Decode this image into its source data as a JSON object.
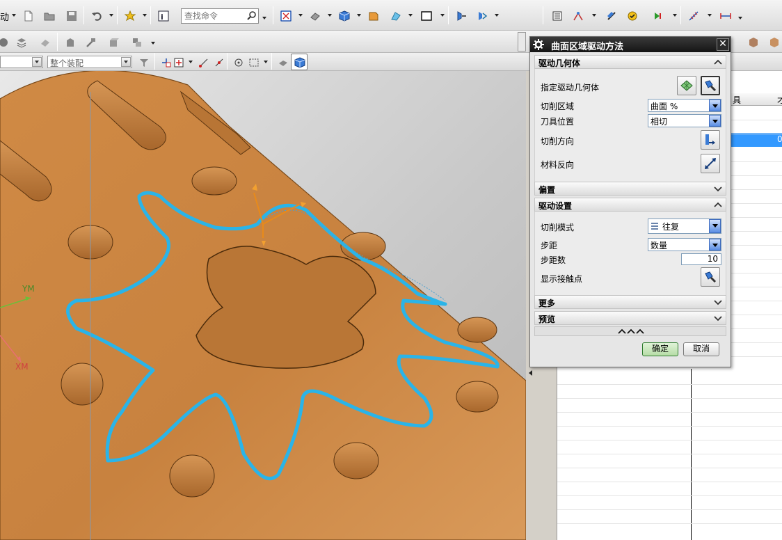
{
  "toolbar": {
    "left_fragment": "动",
    "search_placeholder": "查找命令",
    "filter_all": "",
    "filter_assembly": "整个装配"
  },
  "viewport": {
    "axis_y_label": "YM",
    "axis_x_label": "XM"
  },
  "nav_panel": {
    "header_fragment": "具",
    "header_fragment2": "才",
    "selected_fragment": "0"
  },
  "dialog": {
    "title": "曲面区域驱动方法",
    "close_label": "✕",
    "sections": {
      "drive_geometry": {
        "title": "驱动几何体",
        "specify_label": "指定驱动几何体",
        "cut_area_label": "切削区域",
        "cut_area_value": "曲面 %",
        "tool_position_label": "刀具位置",
        "tool_position_value": "相切",
        "cut_direction_label": "切削方向",
        "material_reverse_label": "材料反向"
      },
      "offset": {
        "title": "偏置"
      },
      "drive_settings": {
        "title": "驱动设置",
        "cut_mode_label": "切削模式",
        "cut_mode_value": "往复",
        "stepover_label": "步距",
        "stepover_value": "数量",
        "step_count_label": "步距数",
        "step_count_value": "10",
        "show_contact_label": "显示接触点"
      },
      "more": {
        "title": "更多"
      },
      "preview": {
        "title": "预览"
      }
    },
    "ok_label": "确定",
    "cancel_label": "取消"
  },
  "colors": {
    "part_orange": "#c8823f",
    "toolpath_cyan": "#2ab4e8",
    "title_bar": "#1e1e1e",
    "selection_blue": "#3399ff"
  }
}
